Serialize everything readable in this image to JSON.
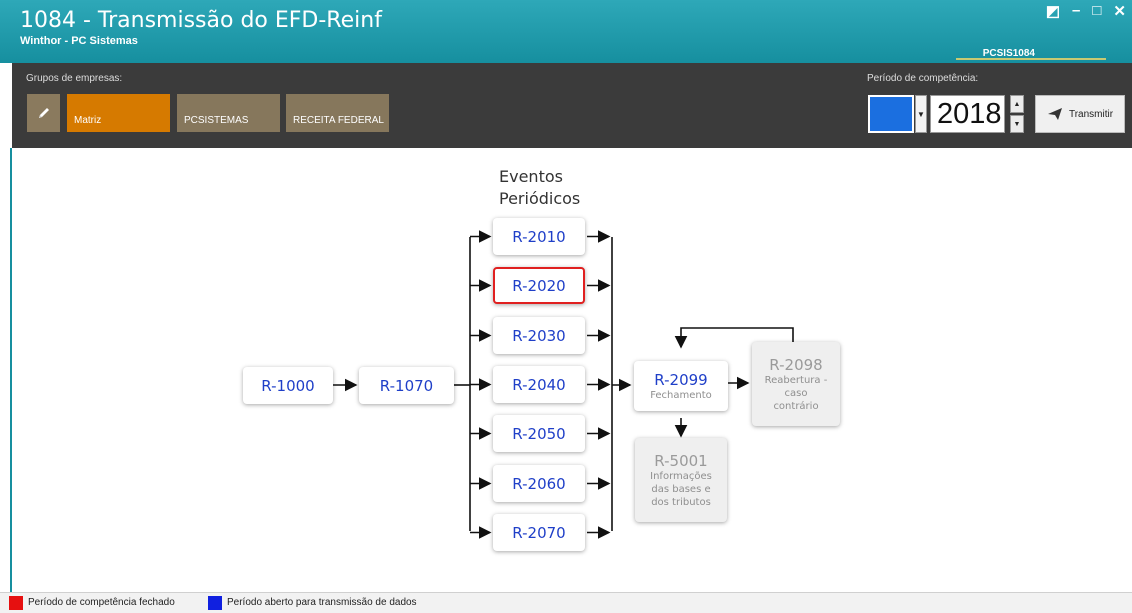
{
  "window": {
    "title": "1084 - Transmissão do EFD-Reinf",
    "subtitle": "Winthor - PC Sistemas",
    "code": "PCSIS1084",
    "controls": {
      "restore": "◩",
      "minimize": "–",
      "maximize": "□",
      "close": "✕"
    }
  },
  "toolbar": {
    "groups_label": "Grupos de empresas:",
    "groups": [
      "Matriz",
      "PCSISTEMAS",
      "RECEITA FEDERAL"
    ],
    "period_label": "Período de competência:",
    "month_color": "#1b6fe0",
    "year": "2018",
    "transmit_label": "Transmitir"
  },
  "diagram": {
    "heading": "Eventos Periódicos",
    "r1000": "R-1000",
    "r1070": "R-1070",
    "periodic": [
      "R-2010",
      "R-2020",
      "R-2030",
      "R-2040",
      "R-2050",
      "R-2060",
      "R-2070"
    ],
    "selected": "R-2020",
    "r2099": {
      "code": "R-2099",
      "sub": "Fechamento"
    },
    "r2098": {
      "code": "R-2098",
      "sub": "Reabertura - caso contrário"
    },
    "r5001": {
      "code": "R-5001",
      "sub": "Informações das bases e dos tributos"
    }
  },
  "legend": {
    "closed_label": "Período de competência fechado",
    "closed_color": "#e61010",
    "open_label": "Período aberto para transmissão de dados",
    "open_color": "#1020e0"
  }
}
